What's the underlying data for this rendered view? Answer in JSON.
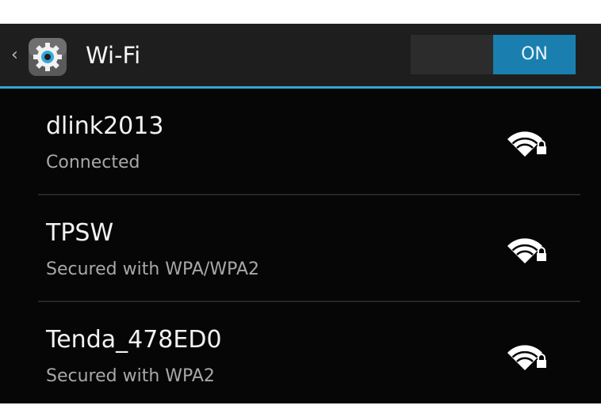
{
  "header": {
    "title": "Wi-Fi"
  },
  "toggle": {
    "state_label": "ON"
  },
  "networks": [
    {
      "ssid": "dlink2013",
      "status": "Connected",
      "icon": "wifi-lock-icon"
    },
    {
      "ssid": "TPSW",
      "status": "Secured with WPA/WPA2",
      "icon": "wifi-lock-icon"
    },
    {
      "ssid": "Tenda_478ED0",
      "status": "Secured with WPA2",
      "icon": "wifi-lock-icon"
    }
  ],
  "colors": {
    "accent": "#33a6d5",
    "toggle_on": "#1a7fae",
    "background": "#060606",
    "action_bar": "#1e1e1e"
  }
}
